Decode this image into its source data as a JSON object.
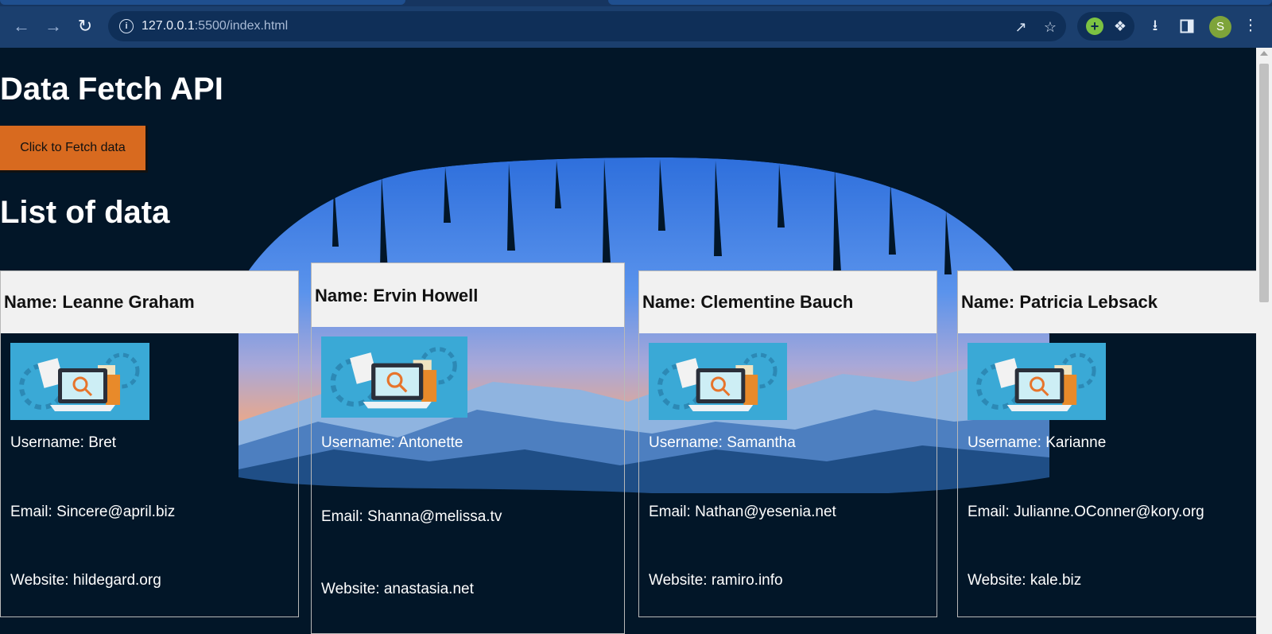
{
  "browser": {
    "url_host": "127.0.0.1",
    "url_path": ":5500/index.html",
    "profile_initial": "S",
    "icons": [
      "back-icon",
      "forward-icon",
      "reload-icon",
      "info-icon",
      "share-icon",
      "star-icon",
      "extension-green-icon",
      "puzzle-icon",
      "download-icon",
      "side-panel-icon",
      "menu-icon"
    ]
  },
  "page": {
    "title": "Data Fetch API",
    "fetch_button": "Click to Fetch data",
    "list_title": "List of data"
  },
  "users": [
    {
      "name": "Name: Leanne Graham",
      "username": "Username: Bret",
      "email": "Email: Sincere@april.biz",
      "website": "Website: hildegard.org"
    },
    {
      "name": "Name: Ervin Howell",
      "username": "Username: Antonette",
      "email": "Email: Shanna@melissa.tv",
      "website": "Website: anastasia.net"
    },
    {
      "name": "Name: Clementine Bauch",
      "username": "Username: Samantha",
      "email": "Email: Nathan@yesenia.net",
      "website": "Website: ramiro.info"
    },
    {
      "name": "Name: Patricia Lebsack",
      "username": "Username: Karianne",
      "email": "Email: Julianne.OConner@kory.org",
      "website": "Website: kale.biz"
    }
  ],
  "colors": {
    "page_bg": "#021628",
    "button_orange": "#d86a1f",
    "chrome_bg": "#1b3f6e",
    "card_header_bg": "#f1f1f1"
  }
}
